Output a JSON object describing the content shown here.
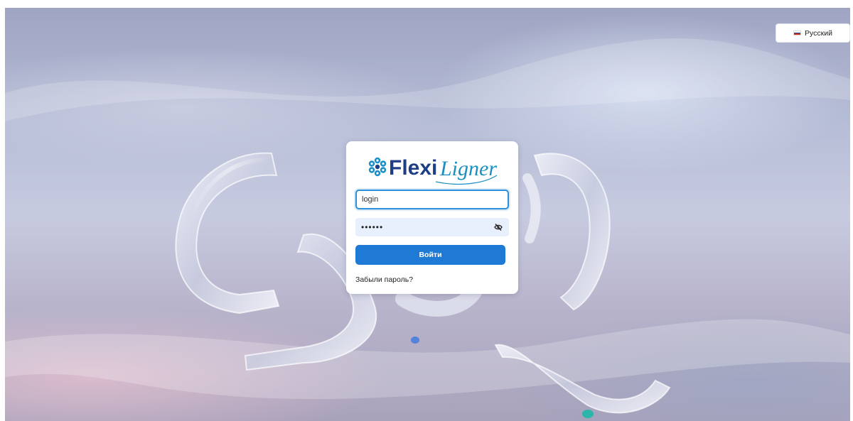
{
  "language": {
    "label": "Русский",
    "flag_icon": "russia-flag-icon"
  },
  "brand": {
    "part1": "Flexi",
    "part2": "Ligner",
    "icon": "snowflake-icon",
    "color": "#1e3f86",
    "accent": "#1a8fc0"
  },
  "form": {
    "login_value": "login",
    "password_value": "••••••",
    "toggle_icon": "eye-slash-icon",
    "submit_label": "Войти",
    "forgot_label": "Забыли пароль?"
  },
  "colors": {
    "primary": "#1f7ad6",
    "field_focus": "#2e8fd8",
    "autofill": "#e8f0fe"
  }
}
